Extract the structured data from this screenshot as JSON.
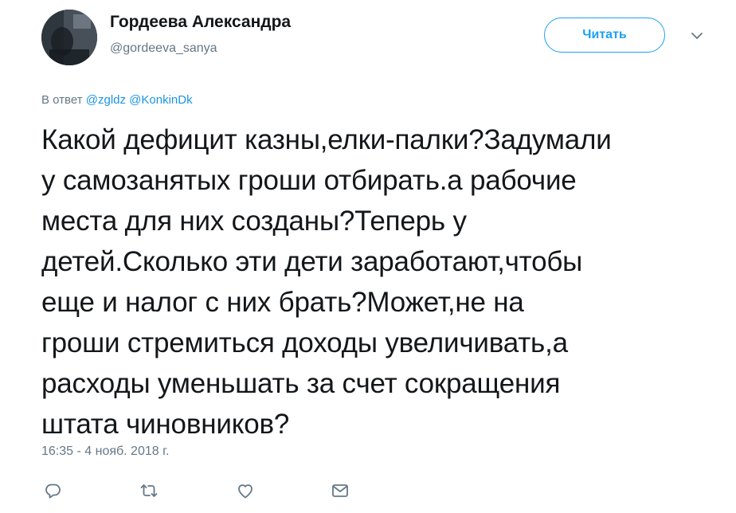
{
  "author": {
    "display_name": "Гордеева Александра",
    "handle": "@gordeeva_sanya",
    "avatar_icon": "user-avatar"
  },
  "follow_button": {
    "label": "Читать",
    "color": "#1da1f2"
  },
  "menu_caret_icon": "chevron-down-icon",
  "reply_context": {
    "prefix": "В ответ",
    "mentions": [
      "@zgldz",
      "@KonkinDk"
    ]
  },
  "tweet": {
    "lines": [
      "Какой дефицит казны,елки-палки?Задумали",
      "у самозанятых гроши отбирать.а рабочие",
      "места для них созданы?Теперь у",
      "детей.Сколько эти дети заработают,чтобы",
      "еще и налог с них брать?Может,не на",
      "гроши стремиться доходы увеличивать,а",
      "расходы уменьшать за счет сокращения",
      "штата чиновников?"
    ]
  },
  "timestamp": "16:35 - 4 нояб. 2018 г.",
  "actions": [
    {
      "name": "reply",
      "icon": "reply-icon"
    },
    {
      "name": "retweet",
      "icon": "retweet-icon"
    },
    {
      "name": "like",
      "icon": "heart-icon"
    },
    {
      "name": "direct-message",
      "icon": "envelope-icon"
    }
  ],
  "colors": {
    "text": "#14171a",
    "secondary": "#657786",
    "link": "#1b95e0",
    "accent": "#1da1f2"
  }
}
